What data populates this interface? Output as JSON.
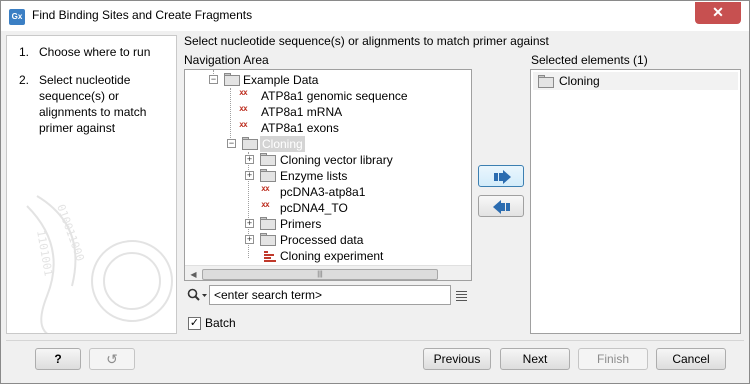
{
  "window": {
    "title": "Find Binding Sites and Create Fragments",
    "app_icon_text": "Gx",
    "close_symbol": "✕"
  },
  "steps": [
    {
      "num": "1.",
      "text": "Choose where to run"
    },
    {
      "num": "2.",
      "text": "Select nucleotide sequence(s) or alignments to match primer against"
    }
  ],
  "main": {
    "instruction": "Select nucleotide sequence(s) or alignments to match primer against",
    "navigation_label": "Navigation Area",
    "selected_label": "Selected elements (1)"
  },
  "tree": [
    {
      "label": "Example Data",
      "icon": "folder-icon",
      "expander": "−"
    },
    {
      "label": "ATP8a1 genomic sequence",
      "icon": "sequence-icon"
    },
    {
      "label": "ATP8a1 mRNA",
      "icon": "sequence-icon"
    },
    {
      "label": "ATP8a1 exons",
      "icon": "sequence-icon"
    },
    {
      "label": "Cloning",
      "icon": "folder-icon",
      "expander": "−",
      "selected": true
    },
    {
      "label": "Cloning vector library",
      "icon": "folder-icon",
      "expander": "+"
    },
    {
      "label": "Enzyme lists",
      "icon": "folder-icon",
      "expander": "+"
    },
    {
      "label": "pcDNA3-atp8a1",
      "icon": "sequence-icon"
    },
    {
      "label": "pcDNA4_TO",
      "icon": "sequence-icon"
    },
    {
      "label": "Primers",
      "icon": "folder-icon",
      "expander": "+"
    },
    {
      "label": "Processed data",
      "icon": "folder-icon",
      "expander": "+"
    },
    {
      "label": "Cloning experiment",
      "icon": "experiment-icon"
    }
  ],
  "search": {
    "placeholder": "<enter search term>"
  },
  "batch": {
    "label": "Batch",
    "checked": true
  },
  "selected_elements": [
    {
      "label": "Cloning",
      "icon": "folder-icon"
    }
  ],
  "buttons": {
    "help": "?",
    "reset_icon": "↺",
    "previous": "Previous",
    "next": "Next",
    "finish": "Finish",
    "cancel": "Cancel"
  },
  "colors": {
    "sequence_icon": "#c0392b",
    "close_button": "#c75050",
    "add_arrow": "#2b6cb0"
  }
}
